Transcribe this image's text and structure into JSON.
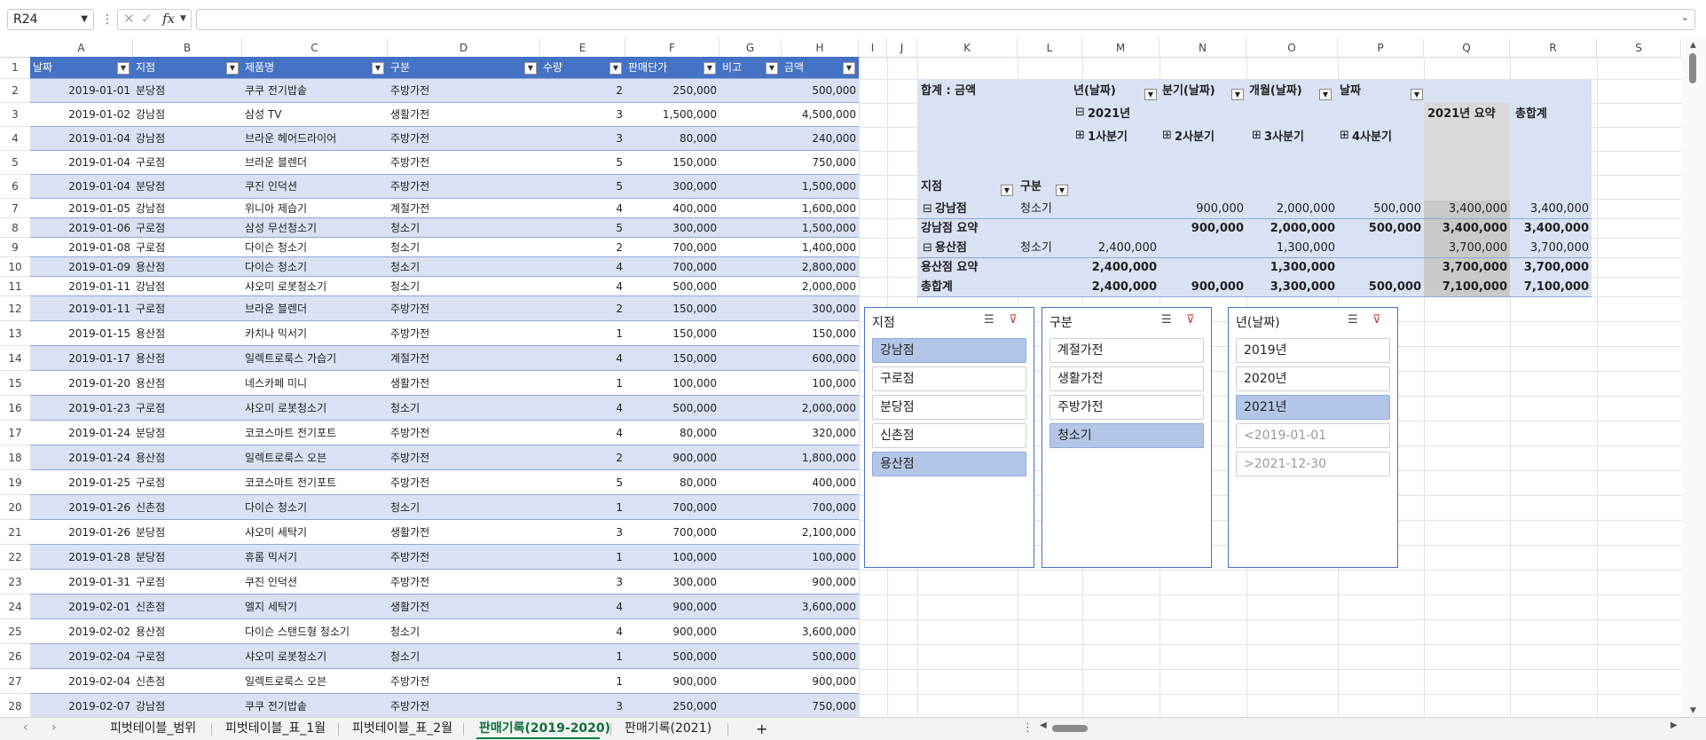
{
  "formula_bar": {
    "name_box": "R24",
    "more_icon": "⋮",
    "cancel_icon": "✕",
    "enter_icon": "✓",
    "fx_label": "fx",
    "formula_value": ""
  },
  "columns": [
    "A",
    "B",
    "C",
    "D",
    "E",
    "F",
    "G",
    "H",
    "I",
    "J",
    "K",
    "L",
    "M",
    "N",
    "O",
    "P",
    "Q",
    "R",
    "S"
  ],
  "row_numbers": [
    "1",
    "2",
    "3",
    "4",
    "5",
    "6",
    "7",
    "8",
    "9",
    "10",
    "11",
    "12",
    "13",
    "14",
    "15",
    "16",
    "17",
    "18",
    "19",
    "20",
    "21",
    "22",
    "23",
    "24",
    "25",
    "26",
    "27",
    "28"
  ],
  "table": {
    "headers": [
      "날짜",
      "지점",
      "제품명",
      "구분",
      "수량",
      "판매단가",
      "비고",
      "금액"
    ],
    "rows": [
      [
        "2019-01-01",
        "분당점",
        "쿠쿠 전기밥솥",
        "주방가전",
        "2",
        "250,000",
        "",
        "500,000"
      ],
      [
        "2019-01-02",
        "강남점",
        "삼성 TV",
        "생활가전",
        "3",
        "1,500,000",
        "",
        "4,500,000"
      ],
      [
        "2019-01-04",
        "강남점",
        "브라운 헤어드라이어",
        "주방가전",
        "3",
        "80,000",
        "",
        "240,000"
      ],
      [
        "2019-01-04",
        "구로점",
        "브라운 블렌더",
        "주방가전",
        "5",
        "150,000",
        "",
        "750,000"
      ],
      [
        "2019-01-04",
        "분당점",
        "쿠진 인덕션",
        "주방가전",
        "5",
        "300,000",
        "",
        "1,500,000"
      ],
      [
        "2019-01-05",
        "강남점",
        "위니아 제습기",
        "계절가전",
        "4",
        "400,000",
        "",
        "1,600,000"
      ],
      [
        "2019-01-06",
        "구로점",
        "삼성 무선청소기",
        "청소기",
        "5",
        "300,000",
        "",
        "1,500,000"
      ],
      [
        "2019-01-08",
        "구로점",
        "다이슨 청소기",
        "청소기",
        "2",
        "700,000",
        "",
        "1,400,000"
      ],
      [
        "2019-01-09",
        "용산점",
        "다이슨 청소기",
        "청소기",
        "4",
        "700,000",
        "",
        "2,800,000"
      ],
      [
        "2019-01-11",
        "강남점",
        "샤오미 로봇청소기",
        "청소기",
        "4",
        "500,000",
        "",
        "2,000,000"
      ],
      [
        "2019-01-11",
        "구로점",
        "브라운 블렌더",
        "주방가전",
        "2",
        "150,000",
        "",
        "300,000"
      ],
      [
        "2019-01-15",
        "용산점",
        "카치나 믹서기",
        "주방가전",
        "1",
        "150,000",
        "",
        "150,000"
      ],
      [
        "2019-01-17",
        "용산점",
        "일렉트로룩스 가습기",
        "계절가전",
        "4",
        "150,000",
        "",
        "600,000"
      ],
      [
        "2019-01-20",
        "용산점",
        "네스카페 미니",
        "생활가전",
        "1",
        "100,000",
        "",
        "100,000"
      ],
      [
        "2019-01-23",
        "구로점",
        "샤오미 로봇청소기",
        "청소기",
        "4",
        "500,000",
        "",
        "2,000,000"
      ],
      [
        "2019-01-24",
        "분당점",
        "코코스마트 전기포트",
        "주방가전",
        "4",
        "80,000",
        "",
        "320,000"
      ],
      [
        "2019-01-24",
        "용산점",
        "일렉트로룩스 오븐",
        "주방가전",
        "2",
        "900,000",
        "",
        "1,800,000"
      ],
      [
        "2019-01-25",
        "구로점",
        "코코스마트 전기포트",
        "주방가전",
        "5",
        "80,000",
        "",
        "400,000"
      ],
      [
        "2019-01-26",
        "신촌점",
        "다이슨 청소기",
        "청소기",
        "1",
        "700,000",
        "",
        "700,000"
      ],
      [
        "2019-01-26",
        "분당점",
        "샤오미 세탁기",
        "생활가전",
        "3",
        "700,000",
        "",
        "2,100,000"
      ],
      [
        "2019-01-28",
        "분당점",
        "휴롬 믹서기",
        "주방가전",
        "1",
        "100,000",
        "",
        "100,000"
      ],
      [
        "2019-01-31",
        "구로점",
        "쿠진 인덕션",
        "주방가전",
        "3",
        "300,000",
        "",
        "900,000"
      ],
      [
        "2019-02-01",
        "신촌점",
        "엘지 세탁기",
        "생활가전",
        "4",
        "900,000",
        "",
        "3,600,000"
      ],
      [
        "2019-02-02",
        "용산점",
        "다이슨 스탠드형 청소기",
        "청소기",
        "4",
        "900,000",
        "",
        "3,600,000"
      ],
      [
        "2019-02-04",
        "구로점",
        "샤오미 로봇청소기",
        "청소기",
        "1",
        "500,000",
        "",
        "500,000"
      ],
      [
        "2019-02-04",
        "신촌점",
        "일렉트로룩스 오븐",
        "주방가전",
        "1",
        "900,000",
        "",
        "900,000"
      ],
      [
        "2019-02-07",
        "강남점",
        "쿠쿠 전기밥솥",
        "주방가전",
        "3",
        "250,000",
        "",
        "750,000"
      ]
    ]
  },
  "pivot": {
    "value_label": "합계 : 금액",
    "col_field_year": "년(날짜)",
    "col_field_quarter": "분기(날짜)",
    "col_field_month": "개월(날짜)",
    "col_field_date": "날짜",
    "year_2021": "2021년",
    "q1": "1사분기",
    "q2": "2사분기",
    "q3": "3사분기",
    "q4": "4사분기",
    "year_subtotal_label": "2021년 요약",
    "grand_total_label": "총합계",
    "row_field_branch": "지점",
    "row_field_category": "구분",
    "rows": {
      "gangnam": {
        "label": "강남점",
        "category": "청소기",
        "q1": "",
        "q2": "900,000",
        "q3": "2,000,000",
        "q4": "500,000",
        "year": "3,400,000",
        "total": "3,400,000"
      },
      "gangnam_sum": {
        "label": "강남점 요약",
        "q1": "",
        "q2": "900,000",
        "q3": "2,000,000",
        "q4": "500,000",
        "year": "3,400,000",
        "total": "3,400,000"
      },
      "yongsan": {
        "label": "용산점",
        "category": "청소기",
        "q1": "2,400,000",
        "q2": "",
        "q3": "1,300,000",
        "q4": "",
        "year": "3,700,000",
        "total": "3,700,000"
      },
      "yongsan_sum": {
        "label": "용산점 요약",
        "q1": "2,400,000",
        "q2": "",
        "q3": "1,300,000",
        "q4": "",
        "year": "3,700,000",
        "total": "3,700,000"
      },
      "grand": {
        "label": "총합계",
        "q1": "2,400,000",
        "q2": "900,000",
        "q3": "3,300,000",
        "q4": "500,000",
        "year": "7,100,000",
        "total": "7,100,000"
      }
    }
  },
  "slicers": {
    "branch": {
      "title": "지점",
      "items": [
        "강남점",
        "구로점",
        "분당점",
        "신촌점",
        "용산점"
      ]
    },
    "category": {
      "title": "구분",
      "items": [
        "계절가전",
        "생활가전",
        "주방가전",
        "청소기"
      ]
    },
    "year": {
      "title": "년(날짜)",
      "items": [
        "2019년",
        "2020년",
        "2021년",
        "<2019-01-01",
        ">2021-12-30"
      ]
    }
  },
  "sheet_tabs": [
    "피벗테이블_범위",
    "피벗테이블_표_1월",
    "피벗테이블_표_2월",
    "판매기록(2019-2020)",
    "판매기록(2021)"
  ],
  "add_sheet": "+",
  "colors": {
    "table_header": "#4472c4",
    "band_light": "#d9e1f2",
    "pivot_bg": "#d9e1f2",
    "pivot_year_col": "#d9d9d9",
    "slicer_selected": "#b4c6e7",
    "active_tab": "#107c41"
  }
}
